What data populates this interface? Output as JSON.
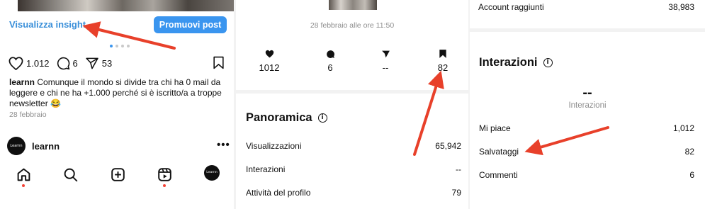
{
  "panel1": {
    "insight_link": "Visualizza insight",
    "promote_button": "Promuovi post",
    "likes": "1.012",
    "comments": "6",
    "shares": "53",
    "caption_user": "learnn",
    "caption_text": "Comunque il mondo si divide tra chi ha 0 mail da leggere e chi ne ha +1.000 perché si è iscritto/a a troppe newsletter 😂",
    "date": "28 febbraio",
    "avatar_text": "Learnn",
    "username": "learnn",
    "more": "•••",
    "nav_avatar_text": "Learnn",
    "icons": [
      "heart-icon",
      "comment-icon",
      "send-icon",
      "bookmark-icon",
      "home-icon",
      "search-icon",
      "new-post-icon",
      "reels-icon"
    ]
  },
  "panel2": {
    "date": "28 febbraio alle ore 11:50",
    "stats": [
      {
        "icon": "heart-icon",
        "value": "1012"
      },
      {
        "icon": "comment-icon",
        "value": "6"
      },
      {
        "icon": "send-icon",
        "value": "--"
      },
      {
        "icon": "bookmark-icon",
        "value": "82"
      }
    ],
    "section_title": "Panoramica",
    "rows": [
      {
        "label": "Visualizzazioni",
        "value": "65,942"
      },
      {
        "label": "Interazioni",
        "value": "--"
      },
      {
        "label": "Attività del profilo",
        "value": "79"
      }
    ]
  },
  "panel3": {
    "reached": {
      "label": "Account raggiunti",
      "value": "38,983"
    },
    "section_title": "Interazioni",
    "summary_value": "--",
    "summary_label": "Interazioni",
    "rows": [
      {
        "label": "Mi piace",
        "value": "1,012"
      },
      {
        "label": "Salvataggi",
        "value": "82"
      },
      {
        "label": "Commenti",
        "value": "6"
      }
    ]
  },
  "colors": {
    "link_blue": "#3a8fd9",
    "button_blue": "#3a95ef",
    "arrow_red": "#e8402a",
    "muted_gray": "#8e8e8e"
  }
}
